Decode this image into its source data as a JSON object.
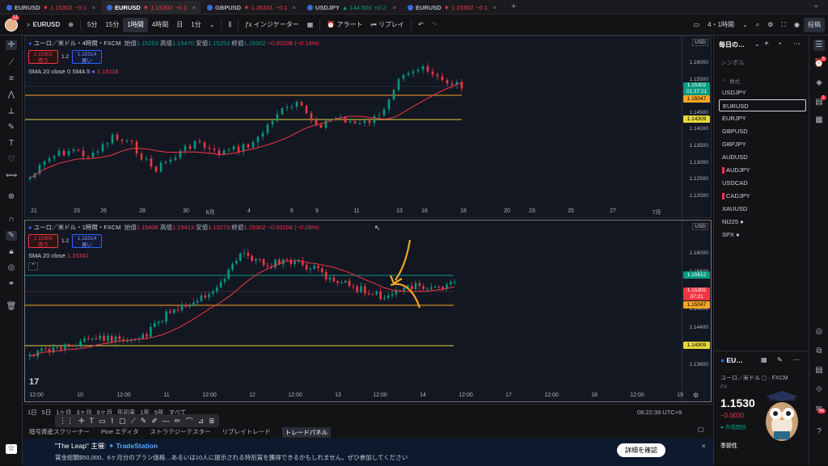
{
  "browser_tabs": [
    {
      "symbol": "EURUSD",
      "price": "▼ 1.15302",
      "change": "−0.1"
    },
    {
      "symbol": "EURUSD",
      "price": "▼ 1.15302",
      "change": "−0.1"
    },
    {
      "symbol": "GBPUSD",
      "price": "▼ 1.35431",
      "change": "−0.1"
    },
    {
      "symbol": "USDJPY",
      "price": "▲ 144.606",
      "change": "+0.2"
    },
    {
      "symbol": "EURUSD",
      "price": "▼ 1.15302",
      "change": "−0.1"
    }
  ],
  "toolbar": {
    "avatar_badge": "11",
    "symbol": "EURUSD",
    "intervals": [
      "5分",
      "15分",
      "1時間",
      "4時間",
      "日",
      "1分"
    ],
    "selected_interval": "1時間",
    "indicators": "インジケーター",
    "alert": "アラート",
    "replay": "リプレイ",
    "layout_name": "4・1時間",
    "publish": "投稿"
  },
  "chart_top": {
    "title": "ユーロ／米ドル・4時間・FXCM",
    "ohlc": {
      "o_label": "始値",
      "o": "1.15253",
      "h_label": "高値",
      "h": "1.15470",
      "l_label": "安値",
      "l": "1.15253",
      "c_label": "終値",
      "c": "1.15302",
      "chg": "−0.00208 (−0.18%)"
    },
    "sell_price": "1.15302",
    "sell_label": "売り",
    "spread": "1.2",
    "buy_price": "1.15314",
    "buy_label": "買い",
    "indicator": "SMA 20 close 0 SMA 5",
    "indicator_value": "1.15116",
    "currency": "USD",
    "price_ticks": [
      "1.16000",
      "1.15500",
      "1.15000",
      "1.14500",
      "1.14000",
      "1.13500",
      "1.13000",
      "1.12500",
      "1.12000"
    ],
    "price_labels": [
      {
        "text": "1.15302",
        "sub": "01:37:21",
        "color": "#089981"
      },
      {
        "text": "1.15047",
        "color": "#f5a623"
      },
      {
        "text": "1.14309",
        "color": "#e6d73c"
      }
    ],
    "time_ticks": [
      "21",
      "23",
      "26",
      "28",
      "30",
      "6月",
      "4",
      "6",
      "9",
      "11",
      "13",
      "16",
      "18",
      "20",
      "23",
      "25",
      "27",
      "7月"
    ]
  },
  "chart_bottom": {
    "title": "ユーロ／米ドル・1時間・FXCM",
    "ohlc": {
      "o_label": "始値",
      "o": "1.15406",
      "h_label": "高値",
      "h": "1.15413",
      "l_label": "安値",
      "l": "1.15273",
      "c_label": "終値",
      "c": "1.15302",
      "chg": "−0.00104 (−0.09%)"
    },
    "sell_price": "1.15300",
    "sell_label": "売り",
    "spread": "1.2",
    "buy_price": "1.15314",
    "buy_label": "買い",
    "indicator": "SMA 20 close",
    "indicator_value": "1.15341",
    "currency": "USD",
    "price_ticks": [
      "1.16000",
      "1.15600",
      "1.15200",
      "1.14800",
      "1.14400",
      "1.14000",
      "1.13600"
    ],
    "price_labels": [
      {
        "text": "1.15612",
        "color": "#089981"
      },
      {
        "text": "1.15302",
        "sub": "37:21",
        "color": "#f23645"
      },
      {
        "text": "1.15047",
        "color": "#f5a623"
      },
      {
        "text": "1.14309",
        "color": "#e6d73c"
      }
    ],
    "time_ticks": [
      "12:00",
      "10",
      "12:00",
      "11",
      "12:00",
      "12",
      "12:00",
      "13",
      "12:00",
      "14",
      "12:00",
      "17",
      "12:00",
      "18",
      "12:00",
      "19"
    ],
    "logo": "17"
  },
  "bottom_bar": {
    "ranges": [
      "1日",
      "5日",
      "1ヶ月",
      "3ヶ月",
      "6ヶ月",
      "年初来",
      "1年",
      "5年",
      "すべて"
    ],
    "clock": "08:22:39 UTC+9"
  },
  "bottom_tabs": [
    "暗号資産スクリーナー",
    "Pine エディタ",
    "ストラテジーテスター",
    "リプレイトレード",
    "トレードパネル"
  ],
  "promo": {
    "title": "\"The Leap\" 主催:",
    "brand": "TradeStation",
    "body": "賞金総額$50,000、6ヶ月分のプラン価格…あるいは10人に提示される特別賞を獲得できるかもしれません。ぜひ参加してください",
    "cta": "詳細を確認"
  },
  "watchlist": {
    "title": "毎日の…",
    "col": "シンボル",
    "group": "株式",
    "items": [
      {
        "name": "USDJPY",
        "flag": false
      },
      {
        "name": "EURUSD",
        "flag": false,
        "sel": true
      },
      {
        "name": "EURJPY",
        "flag": false
      },
      {
        "name": "GBPUSD",
        "flag": false
      },
      {
        "name": "GBPJPY",
        "flag": false
      },
      {
        "name": "AUDUSD",
        "flag": false
      },
      {
        "name": "AUDJPY",
        "flag": true
      },
      {
        "name": "USDCAD",
        "flag": false
      },
      {
        "name": "CADJPY",
        "flag": true
      },
      {
        "name": "XAUUSD",
        "flag": false
      },
      {
        "name": "NI225 ●",
        "flag": false
      },
      {
        "name": "SPX ●",
        "flag": false
      }
    ]
  },
  "detail": {
    "symbol": "EU…",
    "name": "ユーロ／米ドル",
    "exchange": "FXCM",
    "type": "FX",
    "price": "1.1530",
    "change": "−0.0020",
    "status": "市場開放",
    "season": "季節性"
  },
  "right_badges": {
    "alerts": "5",
    "notif": "1",
    "chat": "40"
  },
  "colors": {
    "up": "#089981",
    "down": "#f23645",
    "sma": "#f23645",
    "orange": "#f5a623",
    "yellow": "#e6d73c"
  }
}
